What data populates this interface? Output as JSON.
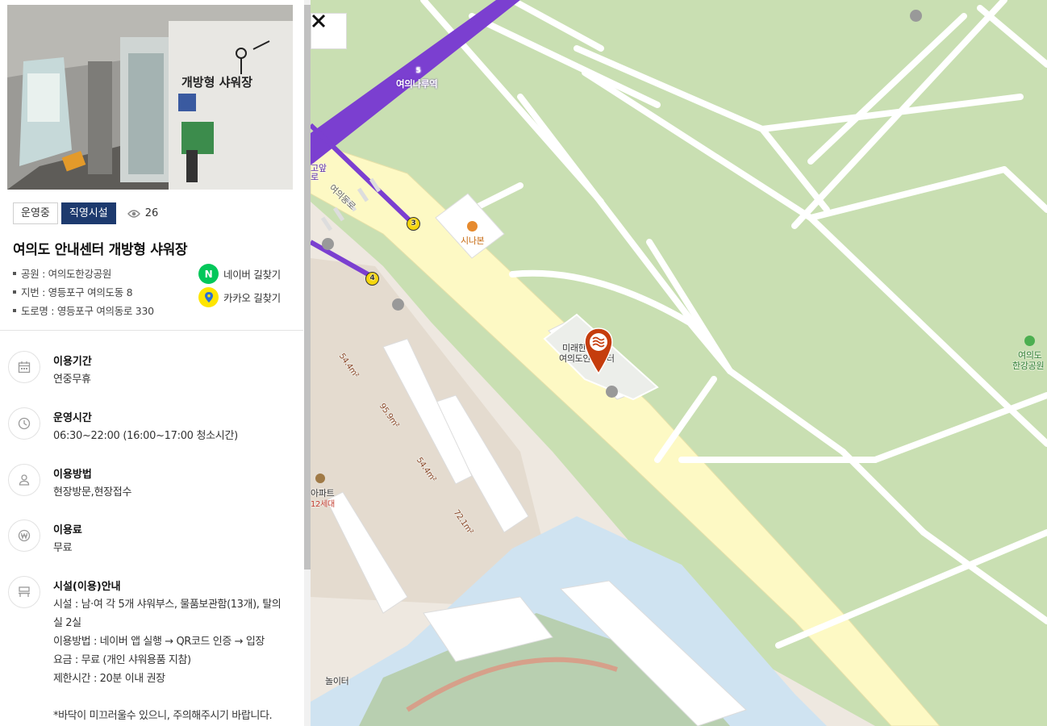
{
  "photo": {
    "sign_text": "개방형 샤워장",
    "alt": ""
  },
  "badges": {
    "status": "운영중",
    "type": "직영시설",
    "views": "26"
  },
  "facility": {
    "title": "여의도 안내센터 개방형 샤워장",
    "park": "공원 : 여의도한강공원",
    "lot_address": "지번 : 영등포구 여의도동 8",
    "road_address": "도로명 : 영등포구 여의동로 330"
  },
  "nav": {
    "naver_label": "네이버 길찾기",
    "naver_letter": "N",
    "kakao_label": "카카오 길찾기"
  },
  "info": {
    "period": {
      "label": "이용기간",
      "value": "연중무휴",
      "icon": "calendar-icon"
    },
    "hours": {
      "label": "운영시간",
      "value": "06:30~22:00 (16:00~17:00 청소시간)",
      "icon": "clock-icon"
    },
    "method": {
      "label": "이용방법",
      "value": "현장방문,현장접수",
      "icon": "person-icon"
    },
    "fee": {
      "label": "이용료",
      "value": "무료",
      "icon": "won-icon"
    },
    "guide": {
      "label": "시설(이용)안내",
      "icon": "bench-icon",
      "lines": [
        "시설 : 남·여 각 5개 샤워부스, 물품보관함(13개), 탈의",
        "실 2실",
        "이용방법 : 네이버 앱 실행 → QR코드 인증 → 입장",
        "요금 : 무료 (개인 샤워용품 지참)",
        "제한시간 : 20분 이내 권장",
        "",
        "*바닥이 미끄러울수 있으니, 주의해주시기 바랍니다."
      ]
    }
  },
  "map": {
    "station": "여의나루역",
    "station_line": "5",
    "road_name": "여의동로",
    "bridge_label": "고앞",
    "bridge_label2": "로",
    "exit3": "3",
    "exit4": "4",
    "cafe": "시나본",
    "marker_name_1": "미래한",
    "marker_name_2": "여의도안내센터",
    "park_label_1": "여의도",
    "park_label_2": "한강공원",
    "apt": "아파트",
    "apt_sub": "12세대",
    "playground": "놀이터",
    "area1": "54.4m²",
    "area2": "95.9m²",
    "area3": "54.4m²",
    "area4": "72.1m²",
    "colors": {
      "subway": "#7b3fd0",
      "road": "#fdf9c4",
      "park": "#c9dfb2",
      "water": "#cfe3f1",
      "marker": "#c53d0d"
    }
  }
}
